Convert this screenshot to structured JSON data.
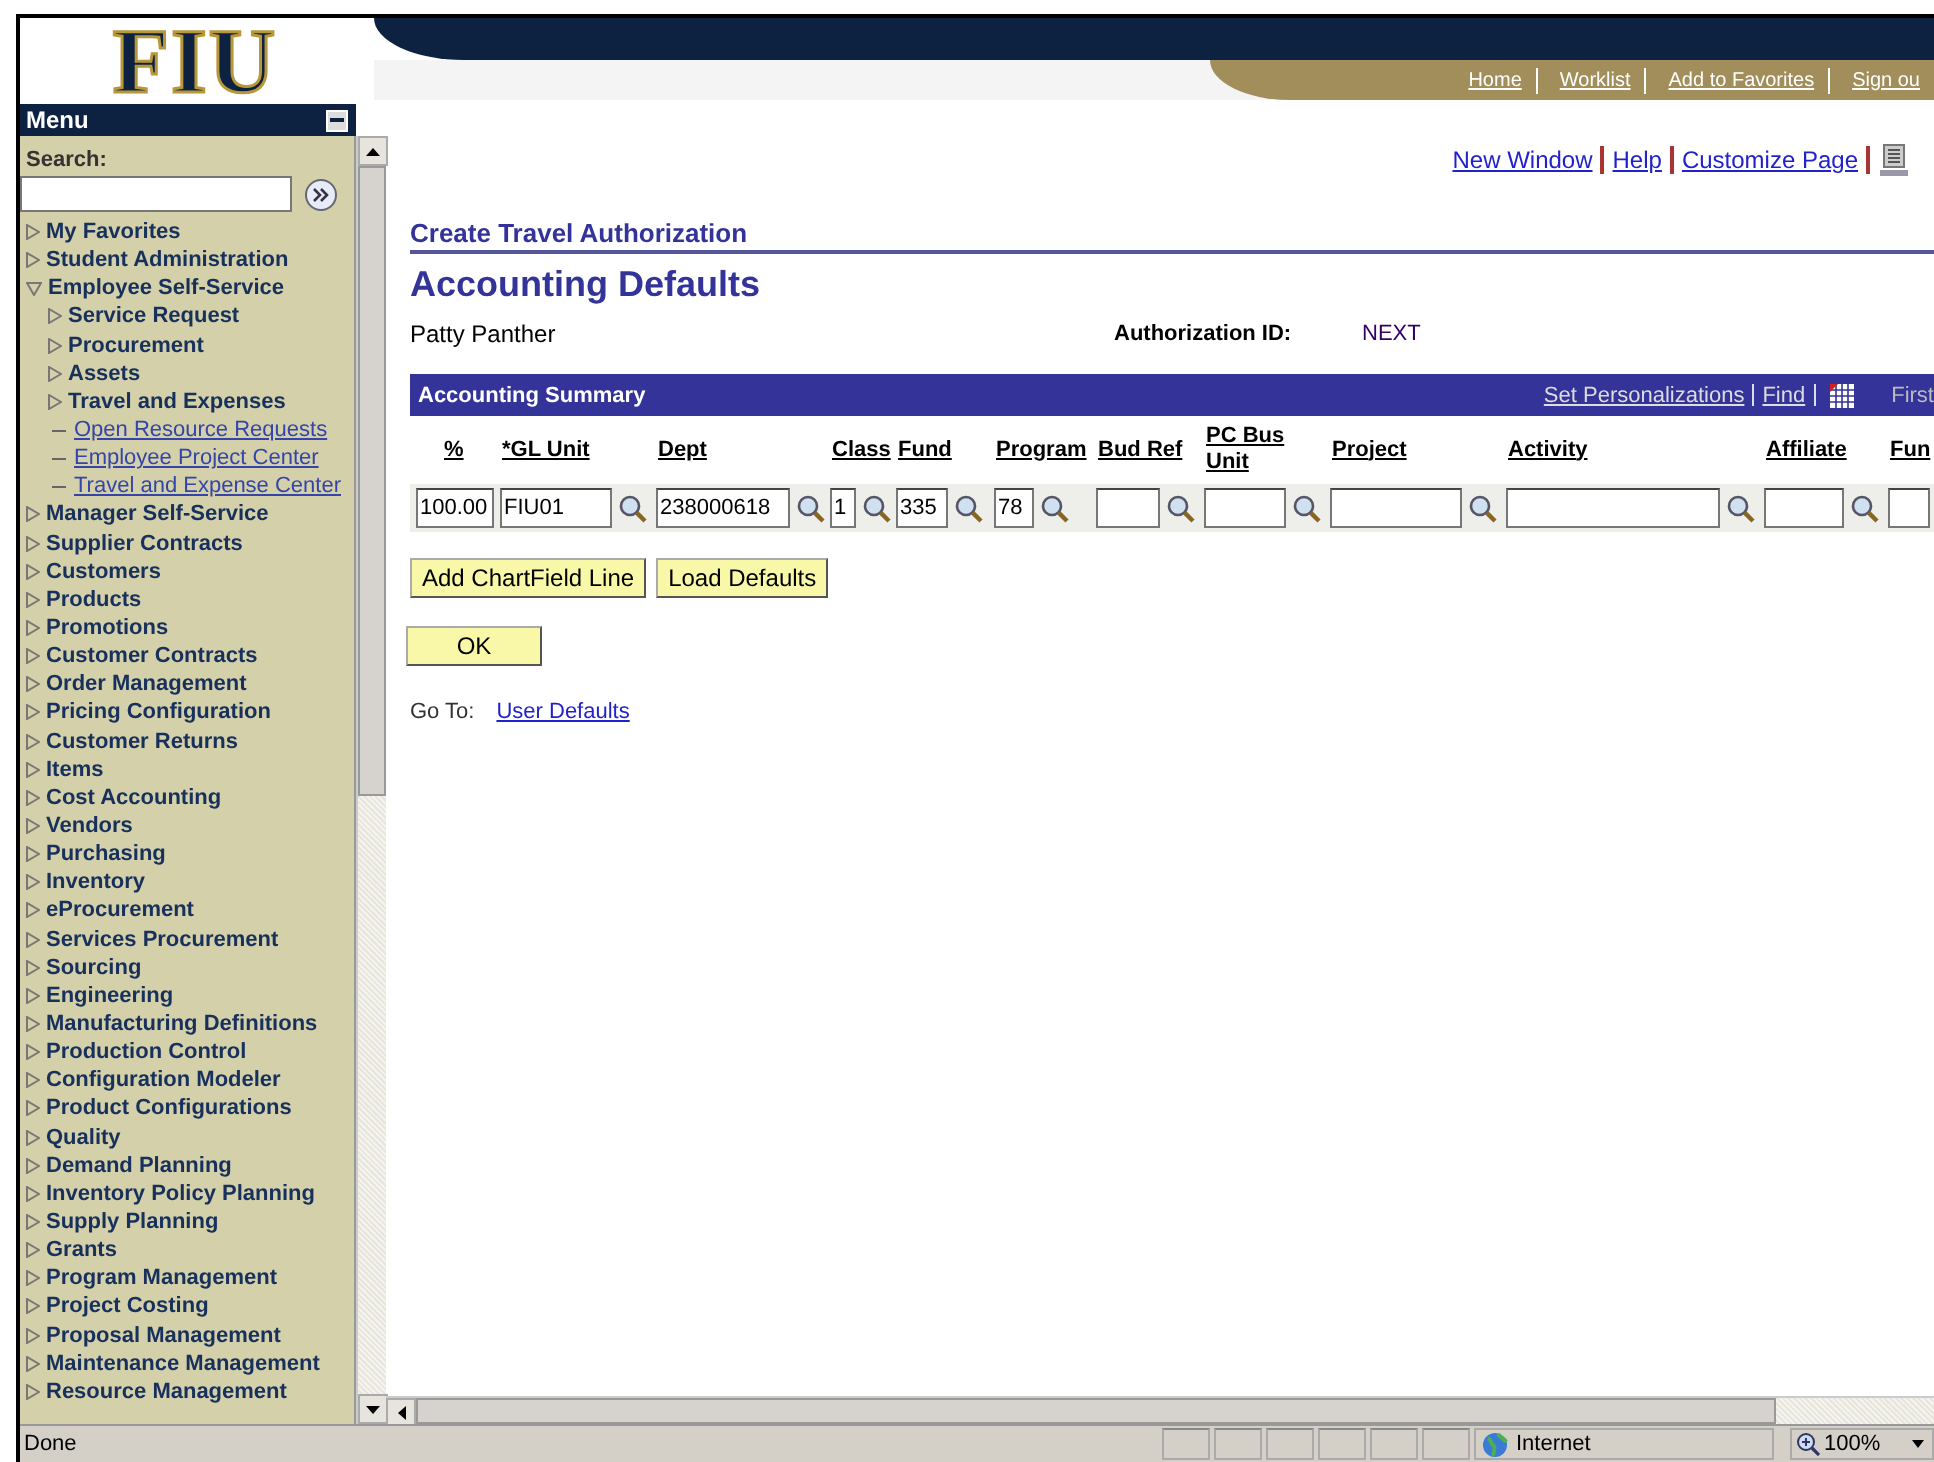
{
  "logo": {
    "text": "FIU"
  },
  "top_nav": {
    "links": [
      "Home",
      "Worklist",
      "Add to Favorites",
      "Sign ou"
    ]
  },
  "menu": {
    "title": "Menu",
    "search": {
      "label": "Search:"
    },
    "items": [
      {
        "label": "My Favorites",
        "kind": "folder",
        "expanded": false
      },
      {
        "label": "Student Administration",
        "kind": "folder",
        "expanded": false
      },
      {
        "label": "Employee Self-Service",
        "kind": "folder",
        "expanded": true,
        "children": [
          {
            "label": "Service Request",
            "kind": "folder",
            "expanded": false
          },
          {
            "label": "Procurement",
            "kind": "folder",
            "expanded": false
          },
          {
            "label": "Assets",
            "kind": "folder",
            "expanded": false
          },
          {
            "label": "Travel and Expenses",
            "kind": "folder",
            "expanded": false
          },
          {
            "label": "Open Resource Requests",
            "kind": "link"
          },
          {
            "label": "Employee Project Center",
            "kind": "link"
          },
          {
            "label": "Travel and Expense Center",
            "kind": "link"
          }
        ]
      },
      {
        "label": "Manager Self-Service",
        "kind": "folder",
        "expanded": false
      },
      {
        "label": "Supplier Contracts",
        "kind": "folder",
        "expanded": false
      },
      {
        "label": "Customers",
        "kind": "folder",
        "expanded": false
      },
      {
        "label": "Products",
        "kind": "folder",
        "expanded": false
      },
      {
        "label": "Promotions",
        "kind": "folder",
        "expanded": false
      },
      {
        "label": "Customer Contracts",
        "kind": "folder",
        "expanded": false
      },
      {
        "label": "Order Management",
        "kind": "folder",
        "expanded": false
      },
      {
        "label": "Pricing Configuration",
        "kind": "folder",
        "expanded": false
      },
      {
        "label": "Customer Returns",
        "kind": "folder",
        "expanded": false
      },
      {
        "label": "Items",
        "kind": "folder",
        "expanded": false
      },
      {
        "label": "Cost Accounting",
        "kind": "folder",
        "expanded": false
      },
      {
        "label": "Vendors",
        "kind": "folder",
        "expanded": false
      },
      {
        "label": "Purchasing",
        "kind": "folder",
        "expanded": false
      },
      {
        "label": "Inventory",
        "kind": "folder",
        "expanded": false
      },
      {
        "label": "eProcurement",
        "kind": "folder",
        "expanded": false
      },
      {
        "label": "Services Procurement",
        "kind": "folder",
        "expanded": false
      },
      {
        "label": "Sourcing",
        "kind": "folder",
        "expanded": false
      },
      {
        "label": "Engineering",
        "kind": "folder",
        "expanded": false
      },
      {
        "label": "Manufacturing Definitions",
        "kind": "folder",
        "expanded": false
      },
      {
        "label": "Production Control",
        "kind": "folder",
        "expanded": false
      },
      {
        "label": "Configuration Modeler",
        "kind": "folder",
        "expanded": false
      },
      {
        "label": "Product Configurations",
        "kind": "folder",
        "expanded": false
      },
      {
        "label": "Quality",
        "kind": "folder",
        "expanded": false
      },
      {
        "label": "Demand Planning",
        "kind": "folder",
        "expanded": false
      },
      {
        "label": "Inventory Policy Planning",
        "kind": "folder",
        "expanded": false
      },
      {
        "label": "Supply Planning",
        "kind": "folder",
        "expanded": false
      },
      {
        "label": "Grants",
        "kind": "folder",
        "expanded": false
      },
      {
        "label": "Program Management",
        "kind": "folder",
        "expanded": false
      },
      {
        "label": "Project Costing",
        "kind": "folder",
        "expanded": false
      },
      {
        "label": "Proposal Management",
        "kind": "folder",
        "expanded": false
      },
      {
        "label": "Maintenance Management",
        "kind": "folder",
        "expanded": false
      },
      {
        "label": "Resource Management",
        "kind": "folder",
        "expanded": false
      }
    ]
  },
  "page_links": [
    "New Window",
    "Help",
    "Customize Page"
  ],
  "section_title": "Create Travel Authorization",
  "page_title": "Accounting Defaults",
  "employee_name": "Patty Panther",
  "authorization": {
    "label": "Authorization ID:",
    "value": "NEXT"
  },
  "grid": {
    "title": "Accounting Summary",
    "links": [
      "Set Personalizations",
      "Find"
    ],
    "nav_text": "First",
    "columns": [
      {
        "header": "%",
        "value": "100.00"
      },
      {
        "header": "*GL Unit",
        "value": "FIU01",
        "lookup": true
      },
      {
        "header": "Dept",
        "value": "238000618",
        "lookup": true
      },
      {
        "header": "Class",
        "value": "1",
        "lookup": true
      },
      {
        "header": "Fund",
        "value": "335",
        "lookup": true
      },
      {
        "header": "Program",
        "value": "78",
        "lookup": true
      },
      {
        "header": "Bud Ref",
        "lookup": true
      },
      {
        "header": "PC Bus Unit",
        "lookup": true
      },
      {
        "header": "Project",
        "lookup": true
      },
      {
        "header": "Activity",
        "lookup": true
      },
      {
        "header": "Affiliate",
        "lookup": true
      },
      {
        "header": "Fun"
      }
    ]
  },
  "buttons": [
    "Add ChartField Line",
    "Load Defaults"
  ],
  "ok_button": "OK",
  "goto": {
    "label": "Go To:",
    "link": "User Defaults"
  },
  "status_bar": {
    "text": "Done",
    "zone": "Internet",
    "zoom": "100%"
  }
}
